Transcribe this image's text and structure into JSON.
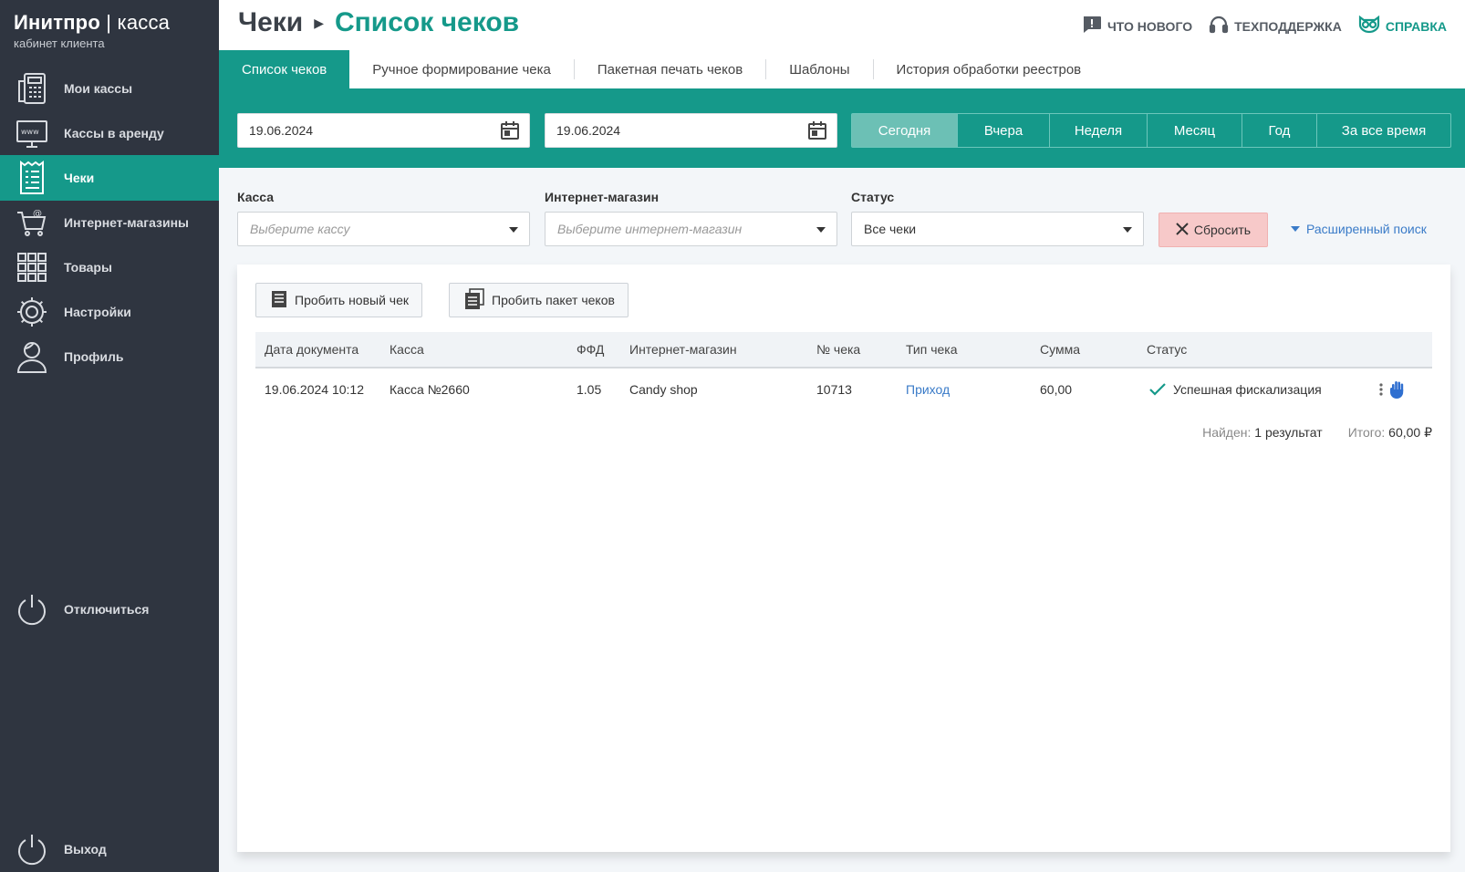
{
  "brand": {
    "name_bold": "Инитпро",
    "name_sep": " | ",
    "name_light": "касса",
    "subtitle": "кабинет клиента"
  },
  "sidebar": {
    "items": [
      {
        "label": "Мои кассы",
        "icon": "cash-register-icon",
        "active": false
      },
      {
        "label": "Кассы в аренду",
        "icon": "monitor-www-icon",
        "active": false
      },
      {
        "label": "Чеки",
        "icon": "receipt-icon",
        "active": true
      },
      {
        "label": "Интернет-магазины",
        "icon": "cart-icon",
        "active": false
      },
      {
        "label": "Товары",
        "icon": "grid-icon",
        "active": false
      },
      {
        "label": "Настройки",
        "icon": "gear-icon",
        "active": false
      },
      {
        "label": "Профиль",
        "icon": "user-icon",
        "active": false
      }
    ],
    "disconnect_label": "Отключиться",
    "logout_label": "Выход"
  },
  "header": {
    "crumb_root": "Чеки",
    "crumb_current": "Список чеков",
    "links": {
      "whats_new": "ЧТО НОВОГО",
      "support": "ТЕХПОДДЕРЖКА",
      "help": "СПРАВКА"
    }
  },
  "tabs": [
    {
      "label": "Список чеков",
      "active": true
    },
    {
      "label": "Ручное формирование чека",
      "active": false
    },
    {
      "label": "Пакетная печать чеков",
      "active": false
    },
    {
      "label": "Шаблоны",
      "active": false
    },
    {
      "label": "История обработки реестров",
      "active": false
    }
  ],
  "dates": {
    "from": "19.06.2024",
    "to": "19.06.2024"
  },
  "periods": [
    {
      "label": "Сегодня",
      "active": true
    },
    {
      "label": "Вчера",
      "active": false
    },
    {
      "label": "Неделя",
      "active": false
    },
    {
      "label": "Месяц",
      "active": false
    },
    {
      "label": "Год",
      "active": false
    },
    {
      "label": "За все время",
      "active": false
    }
  ],
  "filters": {
    "kassa": {
      "label": "Касса",
      "placeholder": "Выберите кассу"
    },
    "shop": {
      "label": "Интернет-магазин",
      "placeholder": "Выберите интернет-магазин"
    },
    "status": {
      "label": "Статус",
      "value": "Все чеки"
    },
    "reset_label": "Сбросить",
    "advanced_label": "Расширенный поиск"
  },
  "actions": {
    "new_receipt": "Пробить новый чек",
    "batch": "Пробить пакет чеков"
  },
  "table": {
    "columns": [
      "Дата документа",
      "Касса",
      "ФФД",
      "Интернет-магазин",
      "№ чека",
      "Тип чека",
      "Сумма",
      "Статус"
    ],
    "rows": [
      {
        "date": "19.06.2024 10:12",
        "kassa": "Касса №2660",
        "ffd": "1.05",
        "shop": "Candy shop",
        "number": "10713",
        "type": "Приход",
        "sum": "60,00",
        "status": "Успешная фискализация"
      }
    ]
  },
  "summary": {
    "found_label": "Найден:",
    "found_value": "1 результат",
    "total_label": "Итого:",
    "total_value": "60,00 ₽"
  },
  "colors": {
    "accent": "#15998a",
    "sidebar": "#2f3540",
    "link": "#3a7bc8",
    "reset": "#f7c9c9"
  }
}
